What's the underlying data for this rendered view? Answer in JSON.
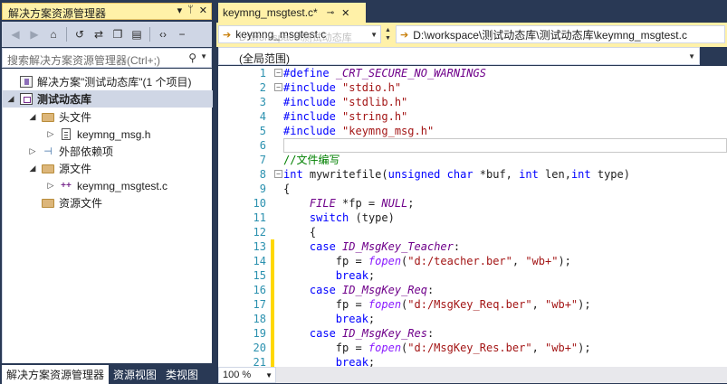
{
  "solution_explorer": {
    "title": "解决方案资源管理器",
    "title_buttons": [
      "▾",
      "ᛘ",
      "✕"
    ],
    "search_placeholder": "搜索解决方案资源管理器(Ctrl+;)",
    "tree": [
      {
        "label": "解决方案\"测试动态库\"(1 个项目)",
        "icon": "solution-icon",
        "arrow": ""
      },
      {
        "label": "测试动态库",
        "icon": "project-icon",
        "arrow": "◢",
        "selected": true
      },
      {
        "label": "头文件",
        "icon": "folder-icon",
        "arrow": "◢"
      },
      {
        "label": "keymng_msg.h",
        "icon": "header-file-icon",
        "arrow": "▷"
      },
      {
        "label": "外部依赖项",
        "icon": "external-deps-icon",
        "arrow": "▷"
      },
      {
        "label": "源文件",
        "icon": "folder-icon",
        "arrow": "◢"
      },
      {
        "label": "keymng_msgtest.c",
        "icon": "cpp-file-icon",
        "arrow": "▷"
      },
      {
        "label": "资源文件",
        "icon": "folder-icon",
        "arrow": ""
      }
    ],
    "bottom_tabs": [
      "解决方案资源管理器",
      "资源视图",
      "类视图"
    ]
  },
  "editor": {
    "tab_name": "keymng_msgtest.c*",
    "tab_pin": "⊸",
    "tab_close": "✕",
    "nav_left": "keymng_msgtest.c",
    "nav_left_ghost": "D:\\workspace\\测试动态库",
    "nav_right": "D:\\workspace\\测试动态库\\测试动态库\\keymng_msgtest.c",
    "scope": "(全局范围)",
    "zoom": "100 %",
    "lines": [
      {
        "n": "1",
        "t": "#define _CRT_SECURE_NO_WARNINGS",
        "fold": "⊟",
        "mark": ""
      },
      {
        "n": "2",
        "t": "#include \"stdio.h\"",
        "fold": "⊟",
        "mark": ""
      },
      {
        "n": "3",
        "t": "#include \"stdlib.h\"",
        "fold": "",
        "mark": ""
      },
      {
        "n": "4",
        "t": "#include \"string.h\"",
        "fold": "",
        "mark": ""
      },
      {
        "n": "5",
        "t": "#include \"keymng_msg.h\"",
        "fold": "",
        "mark": ""
      },
      {
        "n": "6",
        "t": "",
        "fold": "",
        "mark": ""
      },
      {
        "n": "7",
        "t": "//文件编写",
        "fold": "",
        "mark": ""
      },
      {
        "n": "8",
        "t": "int mywritefile(unsigned char *buf, int len,int type)",
        "fold": "⊟",
        "mark": ""
      },
      {
        "n": "9",
        "t": "{",
        "fold": "",
        "mark": ""
      },
      {
        "n": "10",
        "t": "    FILE *fp = NULL;",
        "fold": "",
        "mark": ""
      },
      {
        "n": "11",
        "t": "    switch (type)",
        "fold": "",
        "mark": ""
      },
      {
        "n": "12",
        "t": "    {",
        "fold": "",
        "mark": ""
      },
      {
        "n": "13",
        "t": "    case ID_MsgKey_Teacher:",
        "fold": "",
        "mark": "#ffd800"
      },
      {
        "n": "14",
        "t": "        fp = fopen(\"d:/teacher.ber\", \"wb+\");",
        "fold": "",
        "mark": "#ffd800"
      },
      {
        "n": "15",
        "t": "        break;",
        "fold": "",
        "mark": "#ffd800"
      },
      {
        "n": "16",
        "t": "    case ID_MsgKey_Req:",
        "fold": "",
        "mark": "#ffd800"
      },
      {
        "n": "17",
        "t": "        fp = fopen(\"d:/MsgKey_Req.ber\", \"wb+\");",
        "fold": "",
        "mark": "#ffd800"
      },
      {
        "n": "18",
        "t": "        break;",
        "fold": "",
        "mark": "#ffd800"
      },
      {
        "n": "19",
        "t": "    case ID_MsgKey_Res:",
        "fold": "",
        "mark": "#ffd800"
      },
      {
        "n": "20",
        "t": "        fp = fopen(\"d:/MsgKey_Res.ber\", \"wb+\");",
        "fold": "",
        "mark": "#ffd800"
      },
      {
        "n": "21",
        "t": "        break;",
        "fold": "",
        "mark": "#ffd800"
      }
    ]
  },
  "colors": {
    "chrome": "#293955",
    "active_tab": "#fff1a8",
    "keyword": "#0000ff",
    "preprocessor": "#6f008a",
    "string": "#a31515",
    "comment": "#008000",
    "line_number": "#2b91af",
    "change_marker": "#ffd800"
  }
}
